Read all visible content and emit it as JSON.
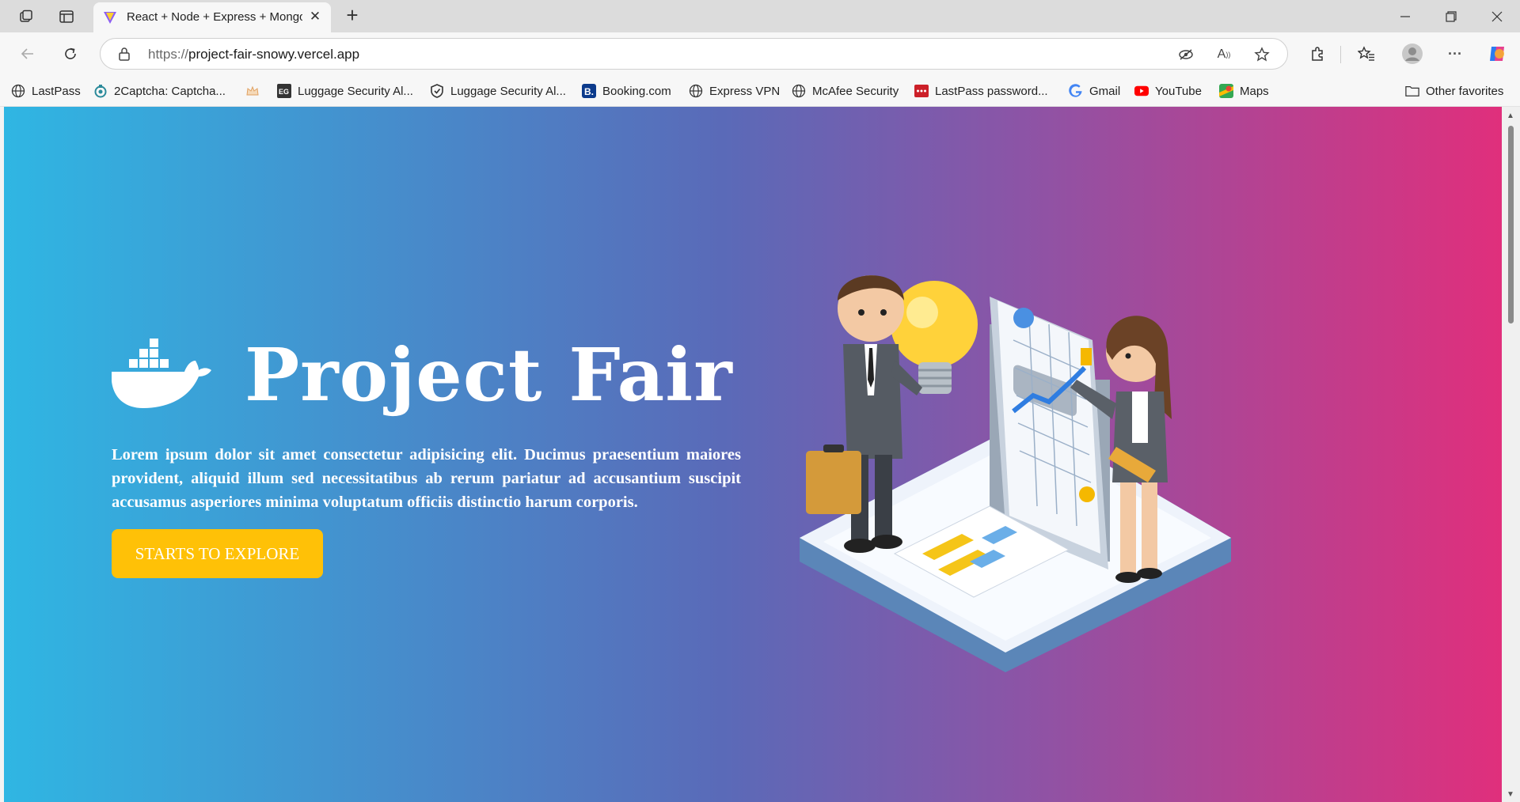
{
  "browser": {
    "tab": {
      "title": "React + Node + Express + MongoDB",
      "close": "✕"
    },
    "new_tab": "+",
    "url": {
      "scheme": "https://",
      "host": "project-fair-snowy.vercel.app"
    },
    "bookmarks": [
      {
        "label": "LastPass",
        "icon": "globe-icon"
      },
      {
        "label": "2Captcha: Captcha...",
        "icon": "captcha-icon"
      },
      {
        "label": "",
        "icon": "crown-icon"
      },
      {
        "label": "Luggage Security Al...",
        "icon": "eg-icon"
      },
      {
        "label": "Luggage Security Al...",
        "icon": "shield-icon"
      },
      {
        "label": "Booking.com",
        "icon": "booking-icon"
      },
      {
        "label": "Express VPN",
        "icon": "globe-icon"
      },
      {
        "label": "McAfee Security",
        "icon": "globe-icon"
      },
      {
        "label": "LastPass password...",
        "icon": "lastpass-icon"
      },
      {
        "label": "Gmail",
        "icon": "google-icon"
      },
      {
        "label": "YouTube",
        "icon": "youtube-icon"
      },
      {
        "label": "Maps",
        "icon": "maps-icon"
      }
    ],
    "other_favorites": "Other favorites"
  },
  "page": {
    "title": "Project Fair",
    "description": "Lorem ipsum dolor sit amet consectetur adipisicing elit. Ducimus praesentium maiores provident, aliquid illum sed necessitatibus ab rerum pariatur ad accusantium suscipit accusamus asperiores minima voluptatum officiis distinctio harum corporis.",
    "cta_label": "STARTS TO EXPLORE",
    "logo_icon": "docker-whale-icon",
    "illustration": "business-people-with-chart-and-lightbulb",
    "colors": {
      "gradient_start": "#2fb6e3",
      "gradient_mid": "#5a6ab8",
      "gradient_end": "#e02f7c",
      "cta": "#ffc107"
    }
  }
}
